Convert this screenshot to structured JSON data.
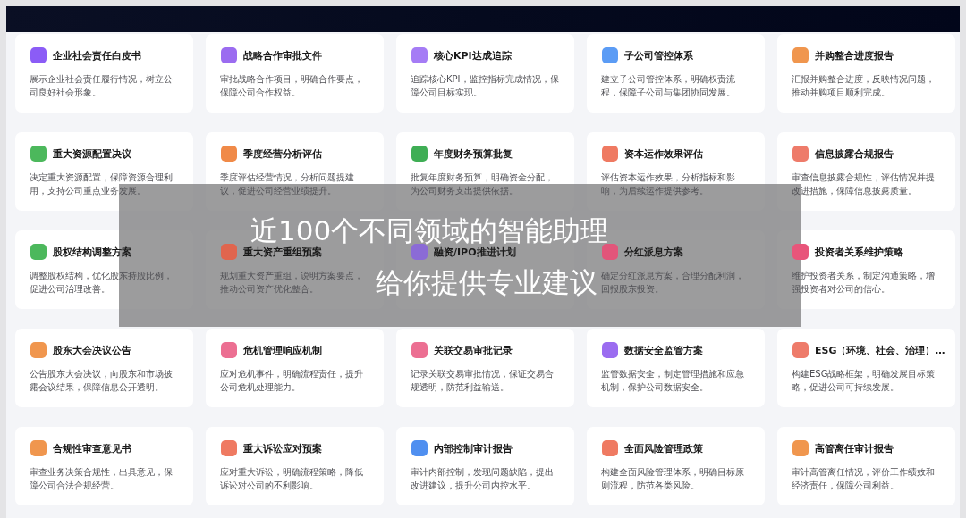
{
  "cards": [
    {
      "title": "企业社会责任白皮书",
      "desc": "展示企业社会责任履行情况，树立公司良好社会形象。",
      "color": "#8b5cf6"
    },
    {
      "title": "战略合作审批文件",
      "desc": "审批战略合作项目，明确合作要点，保障公司合作权益。",
      "color": "#9b6cf0"
    },
    {
      "title": "核心KPI达成追踪",
      "desc": "追踪核心KPI，监控指标完成情况，保障公司目标实现。",
      "color": "#a57cf5"
    },
    {
      "title": "子公司管控体系",
      "desc": "建立子公司管控体系，明确权责流程，保障子公司与集团协同发展。",
      "color": "#5b9cf5"
    },
    {
      "title": "并购整合进度报告",
      "desc": "汇报并购整合进度，反映情况问题，推动并购项目顺利完成。",
      "color": "#f0964e"
    },
    {
      "title": "重大资源配置决议",
      "desc": "决定重大资源配置，保障资源合理利用，支持公司重点业务发展。",
      "color": "#4cb85c"
    },
    {
      "title": "季度经营分析评估",
      "desc": "季度评估经营情况，分析问题提建议，促进公司经营业绩提升。",
      "color": "#f08a48"
    },
    {
      "title": "年度财务预算批复",
      "desc": "批复年度财务预算，明确资金分配，为公司财务支出提供依据。",
      "color": "#3fae55"
    },
    {
      "title": "资本运作效果评估",
      "desc": "评估资本运作效果，分析指标和影响，为后续运作提供参考。",
      "color": "#ef7a62"
    },
    {
      "title": "信息披露合规报告",
      "desc": "审查信息披露合规性，评估情况并提改进措施，保障信息披露质量。",
      "color": "#ee7b6a"
    },
    {
      "title": "股权结构调整方案",
      "desc": "调整股权结构，优化股东持股比例，促进公司治理改善。",
      "color": "#4cb85c"
    },
    {
      "title": "重大资产重组预案",
      "desc": "规划重大资产重组，说明方案要点，推动公司资产优化整合。",
      "color": "#e0654e"
    },
    {
      "title": "融资/IPO推进计划",
      "color": "#8b6bd6"
    },
    {
      "title": "分红派息方案",
      "desc": "确定分红派息方案，合理分配利润，回报股东投资。",
      "color": "#e2557a"
    },
    {
      "title": "投资者关系维护策略",
      "desc": "维护投资者关系，制定沟通策略，增强投资者对公司的信心。",
      "color": "#e8557a"
    },
    {
      "title": "股东大会决议公告",
      "desc": "公告股东大会决议，向股东和市场披露会议结果，保障信息公开透明。",
      "color": "#f0964e"
    },
    {
      "title": "危机管理响应机制",
      "desc": "应对危机事件，明确流程责任，提升公司危机处理能力。",
      "color": "#ec6f92"
    },
    {
      "title": "关联交易审批记录",
      "desc": "记录关联交易审批情况，保证交易合规透明，防范利益输送。",
      "color": "#ec6f92"
    },
    {
      "title": "数据安全监管方案",
      "desc": "监管数据安全，制定管理措施和应急机制，保护公司数据安全。",
      "color": "#9b6cf0"
    },
    {
      "title": "ESG（环境、社会、治理）…",
      "desc": "构建ESG战略框架，明确发展目标策略，促进公司可持续发展。",
      "color": "#ee7b6a"
    },
    {
      "title": "合规性审查意见书",
      "desc": "审查业务决策合规性，出具意见，保障公司合法合规经营。",
      "color": "#f0964e"
    },
    {
      "title": "重大诉讼应对预案",
      "desc": "应对重大诉讼，明确流程策略，降低诉讼对公司的不利影响。",
      "color": "#ef7a62"
    },
    {
      "title": "内部控制审计报告",
      "desc": "审计内部控制，发现问题缺陷，提出改进建议，提升公司内控水平。",
      "color": "#4f8ff0"
    },
    {
      "title": "全面风险管理政策",
      "desc": "构建全面风险管理体系，明确目标原则流程，防范各类风险。",
      "color": "#ef7a62"
    },
    {
      "title": "高管离任审计报告",
      "desc": "审计高管离任情况，评价工作绩效和经济责任，保障公司利益。",
      "color": "#f0964e"
    }
  ],
  "overlay": {
    "lines": [
      "近100个不同领域的智能助理",
      "给你提供专业建议"
    ]
  }
}
